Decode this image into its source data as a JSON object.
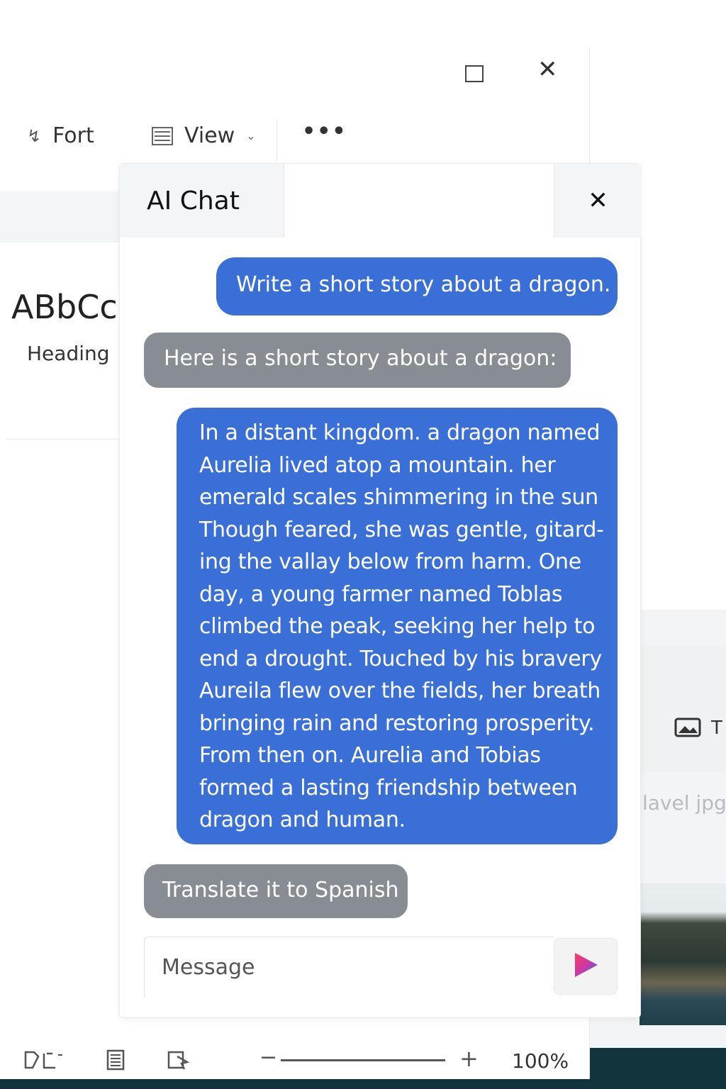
{
  "window": {
    "maximize_icon": "maximize-icon",
    "close_icon": "close-icon"
  },
  "toolbar": {
    "font_label": "Fort",
    "view_label": "View",
    "more_label": "•••"
  },
  "styles": {
    "preview_text": "ABbCcl",
    "style_name": "Heading"
  },
  "chat": {
    "title": "AI Chat",
    "close_glyph": "✕",
    "messages": [
      {
        "role": "user",
        "text": "Write a short story about a dragon."
      },
      {
        "role": "assistant",
        "text": "Here is a short story about a dragon:"
      },
      {
        "role": "user",
        "text": "In a distant kingdom. a dragon named\nAurelia lived atop a mountain. her\nemerald scales shimmering in the sun\nThough feared, she was gentle, gitard-\ning the vallay below from harm. One\nday, a young farmer named Toblas\nclimbed the peak, seeking her help to\nend a drought. Touched by his bravery\nAureila flew over the fields, her breath\nbringing rain and restoring prosperity.\nFrom then on. Aurelia and Tobias\nformed a lasting friendship between\ndragon and human."
      },
      {
        "role": "assistant",
        "text": "Translate it to Spanish"
      }
    ],
    "input_placeholder": "Message",
    "send_icon": "send-icon"
  },
  "side_card": {
    "label": "T",
    "filename": "lavel jpg"
  },
  "statusbar": {
    "zoom_level": "100%",
    "zoom_minus": "−",
    "zoom_plus": "+"
  },
  "colors": {
    "user_bubble": "#3a6fd8",
    "assistant_bubble": "#888d93",
    "taskbar": "#12353d"
  }
}
